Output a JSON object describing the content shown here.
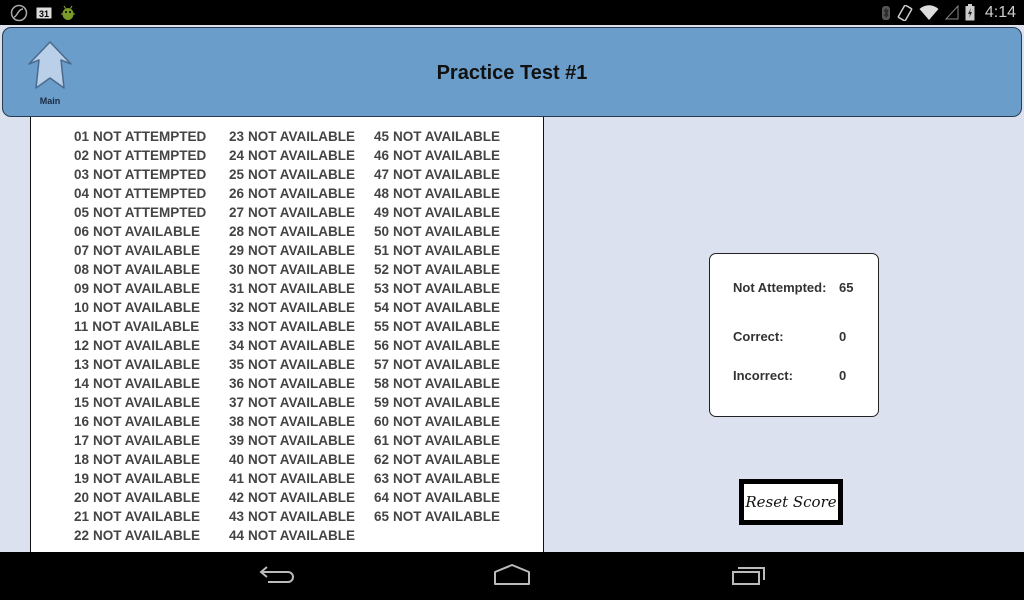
{
  "status_bar": {
    "time": "4:14",
    "left_icons": [
      "sync-icon",
      "calendar-31-icon",
      "android-debug-icon"
    ],
    "calendar_day": "31",
    "right_icons": [
      "bluetooth-icon",
      "screen-rotation-icon",
      "wifi-icon",
      "cell-signal-icon",
      "battery-charging-icon"
    ]
  },
  "header": {
    "title": "Practice Test #1",
    "main_button_label": "Main",
    "background_color": "#6a9dc9"
  },
  "questions": {
    "columns": [
      [
        {
          "num": "01",
          "status": "NOT ATTEMPTED"
        },
        {
          "num": "02",
          "status": "NOT ATTEMPTED"
        },
        {
          "num": "03",
          "status": "NOT ATTEMPTED"
        },
        {
          "num": "04",
          "status": "NOT ATTEMPTED"
        },
        {
          "num": "05",
          "status": "NOT ATTEMPTED"
        },
        {
          "num": "06",
          "status": "NOT AVAILABLE"
        },
        {
          "num": "07",
          "status": "NOT AVAILABLE"
        },
        {
          "num": "08",
          "status": "NOT AVAILABLE"
        },
        {
          "num": "09",
          "status": "NOT AVAILABLE"
        },
        {
          "num": "10",
          "status": "NOT AVAILABLE"
        },
        {
          "num": "11",
          "status": "NOT AVAILABLE"
        },
        {
          "num": "12",
          "status": "NOT AVAILABLE"
        },
        {
          "num": "13",
          "status": "NOT AVAILABLE"
        },
        {
          "num": "14",
          "status": "NOT AVAILABLE"
        },
        {
          "num": "15",
          "status": "NOT AVAILABLE"
        },
        {
          "num": "16",
          "status": "NOT AVAILABLE"
        },
        {
          "num": "17",
          "status": "NOT AVAILABLE"
        },
        {
          "num": "18",
          "status": "NOT AVAILABLE"
        },
        {
          "num": "19",
          "status": "NOT AVAILABLE"
        },
        {
          "num": "20",
          "status": "NOT AVAILABLE"
        },
        {
          "num": "21",
          "status": "NOT AVAILABLE"
        },
        {
          "num": "22",
          "status": "NOT AVAILABLE"
        }
      ],
      [
        {
          "num": "23",
          "status": "NOT AVAILABLE"
        },
        {
          "num": "24",
          "status": "NOT AVAILABLE"
        },
        {
          "num": "25",
          "status": "NOT AVAILABLE"
        },
        {
          "num": "26",
          "status": "NOT AVAILABLE"
        },
        {
          "num": "27",
          "status": "NOT AVAILABLE"
        },
        {
          "num": "28",
          "status": "NOT AVAILABLE"
        },
        {
          "num": "29",
          "status": "NOT AVAILABLE"
        },
        {
          "num": "30",
          "status": "NOT AVAILABLE"
        },
        {
          "num": "31",
          "status": "NOT AVAILABLE"
        },
        {
          "num": "32",
          "status": "NOT AVAILABLE"
        },
        {
          "num": "33",
          "status": "NOT AVAILABLE"
        },
        {
          "num": "34",
          "status": "NOT AVAILABLE"
        },
        {
          "num": "35",
          "status": "NOT AVAILABLE"
        },
        {
          "num": "36",
          "status": "NOT AVAILABLE"
        },
        {
          "num": "37",
          "status": "NOT AVAILABLE"
        },
        {
          "num": "38",
          "status": "NOT AVAILABLE"
        },
        {
          "num": "39",
          "status": "NOT AVAILABLE"
        },
        {
          "num": "40",
          "status": "NOT AVAILABLE"
        },
        {
          "num": "41",
          "status": "NOT AVAILABLE"
        },
        {
          "num": "42",
          "status": "NOT AVAILABLE"
        },
        {
          "num": "43",
          "status": "NOT AVAILABLE"
        },
        {
          "num": "44",
          "status": "NOT AVAILABLE"
        }
      ],
      [
        {
          "num": "45",
          "status": "NOT AVAILABLE"
        },
        {
          "num": "46",
          "status": "NOT AVAILABLE"
        },
        {
          "num": "47",
          "status": "NOT AVAILABLE"
        },
        {
          "num": "48",
          "status": "NOT AVAILABLE"
        },
        {
          "num": "49",
          "status": "NOT AVAILABLE"
        },
        {
          "num": "50",
          "status": "NOT AVAILABLE"
        },
        {
          "num": "51",
          "status": "NOT AVAILABLE"
        },
        {
          "num": "52",
          "status": "NOT AVAILABLE"
        },
        {
          "num": "53",
          "status": "NOT AVAILABLE"
        },
        {
          "num": "54",
          "status": "NOT AVAILABLE"
        },
        {
          "num": "55",
          "status": "NOT AVAILABLE"
        },
        {
          "num": "56",
          "status": "NOT AVAILABLE"
        },
        {
          "num": "57",
          "status": "NOT AVAILABLE"
        },
        {
          "num": "58",
          "status": "NOT AVAILABLE"
        },
        {
          "num": "59",
          "status": "NOT AVAILABLE"
        },
        {
          "num": "60",
          "status": "NOT AVAILABLE"
        },
        {
          "num": "61",
          "status": "NOT AVAILABLE"
        },
        {
          "num": "62",
          "status": "NOT AVAILABLE"
        },
        {
          "num": "63",
          "status": "NOT AVAILABLE"
        },
        {
          "num": "64",
          "status": "NOT AVAILABLE"
        },
        {
          "num": "65",
          "status": "NOT AVAILABLE"
        }
      ]
    ]
  },
  "score": {
    "not_attempted_label": "Not Attempted:",
    "not_attempted_value": "65",
    "correct_label": "Correct:",
    "correct_value": "0",
    "incorrect_label": "Incorrect:",
    "incorrect_value": "0"
  },
  "reset_button_label": "Reset Score",
  "nav_bar": {
    "buttons": [
      "back-icon",
      "home-icon",
      "recent-apps-icon"
    ]
  }
}
